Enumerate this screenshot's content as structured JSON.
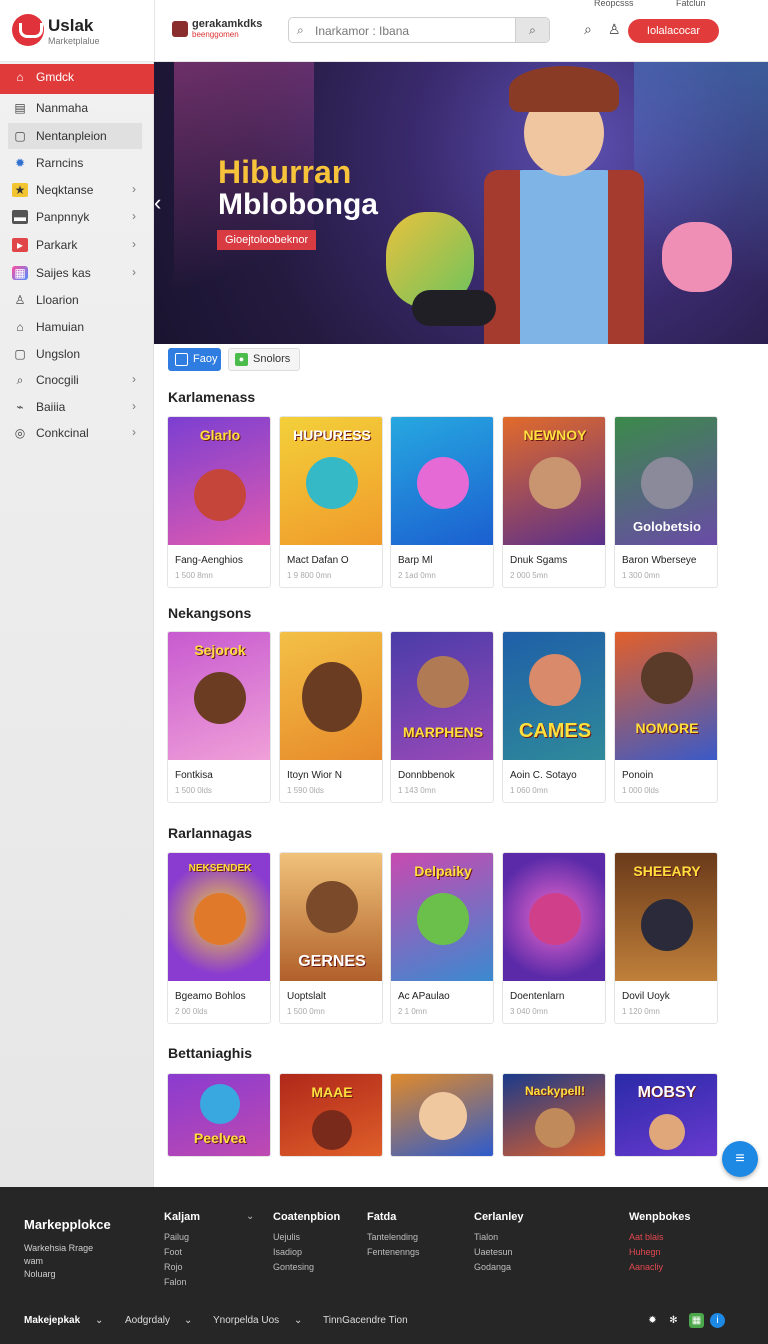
{
  "header": {
    "logo_name": "Uslak",
    "logo_sub": "Marketplalue",
    "brand2_name": "gerakamkdks",
    "brand2_sub": "beenggomen",
    "search_placeholder": "Inarkamor : Ibana",
    "cta_label": "Iolalacocar",
    "topmini_left": "Reopcsss",
    "topmini_right": "Fatclun"
  },
  "sidebar": {
    "items": [
      {
        "label": "Gmdck",
        "icon": "home-icon"
      },
      {
        "label": "Nanmaha",
        "icon": "list-icon"
      },
      {
        "label": "Nentanpleion",
        "icon": "page-icon"
      },
      {
        "label": "Rarncins",
        "icon": "gear-icon"
      },
      {
        "label": "Neqktanse",
        "icon": "star-icon"
      },
      {
        "label": "Panpnnyk",
        "icon": "monitor-icon"
      },
      {
        "label": "Parkark",
        "icon": "play-icon"
      },
      {
        "label": "Saijes kas",
        "icon": "apps-icon"
      },
      {
        "label": "Lloarion",
        "icon": "people-icon"
      },
      {
        "label": "Hamuian",
        "icon": "house-icon"
      },
      {
        "label": "Ungslon",
        "icon": "square-icon"
      },
      {
        "label": "Cnocgili",
        "icon": "search-icon"
      },
      {
        "label": "Baiiia",
        "icon": "chart-icon"
      },
      {
        "label": "Conkcinal",
        "icon": "circle-icon"
      }
    ]
  },
  "hero": {
    "title1": "Hiburran",
    "title2": "Mblobonga",
    "tag": "Gioejtoloobeknor"
  },
  "chips": [
    {
      "label": "Faoy"
    },
    {
      "label": "Snolors"
    }
  ],
  "sections": [
    {
      "title": "Karlamenass",
      "cards": [
        {
          "art_text": "Glarlo",
          "title": "Fang-Aenghios",
          "sub": "1 500 8mn"
        },
        {
          "art_text": "HUPURESS",
          "title": "Mact Dafan O",
          "sub": "1 9 800 0mn"
        },
        {
          "art_text": "",
          "title": "Barp Ml",
          "sub": "2 1ad 0mn"
        },
        {
          "art_text": "NEWNOY",
          "title": "Dnuk Sgams",
          "sub": "2 000 5mn"
        },
        {
          "art_text": "Golobetsio",
          "title": "Baron Wberseye",
          "sub": "1 300 0mn"
        }
      ]
    },
    {
      "title": "Nekangsons",
      "cards": [
        {
          "art_text": "Sejorok",
          "title": "Fontkisa",
          "sub": "1 500 0lds"
        },
        {
          "art_text": "",
          "title": "Itoyn Wior N",
          "sub": "1 590 0lds"
        },
        {
          "art_text": "MARPHENS",
          "title": "Donnbbenok",
          "sub": "1 143 0mn"
        },
        {
          "art_text": "CAMES",
          "title": "Aoin C. Sotayo",
          "sub": "1 060 0mn"
        },
        {
          "art_text": "NOMORE",
          "title": "Ponoin",
          "sub": "1 000 0lds"
        }
      ]
    },
    {
      "title": "Rarlannagas",
      "cards": [
        {
          "art_text": "NEKSENDEK",
          "title": "Bgeamo Bohlos",
          "sub": "2 00 0lds"
        },
        {
          "art_text": "GERNES",
          "title": "Uoptslalt",
          "sub": "1 500 0mn"
        },
        {
          "art_text": "Delpaiky",
          "title": "Ac APaulao",
          "sub": "2 1 0mn"
        },
        {
          "art_text": "",
          "title": "Doentenlarn",
          "sub": "3 040 0mn"
        },
        {
          "art_text": "SHEEARY",
          "title": "Dovil Uoyk",
          "sub": "1 120 0mn"
        }
      ]
    },
    {
      "title": "Bettaniaghis",
      "cards": [
        {
          "art_text": "Peelvea",
          "title": "",
          "sub": ""
        },
        {
          "art_text": "MAAE",
          "title": "",
          "sub": ""
        },
        {
          "art_text": "",
          "title": "",
          "sub": ""
        },
        {
          "art_text": "Nackypell!",
          "title": "",
          "sub": ""
        },
        {
          "art_text": "MOBSY",
          "title": "",
          "sub": ""
        }
      ]
    }
  ],
  "footer": {
    "brand": "Markepplokce",
    "brand_lines": [
      "Warkehsia Rrage",
      "wam",
      "Noluarg"
    ],
    "columns": [
      {
        "title": "Kaljam",
        "links": [
          "Pailug",
          "Foot",
          "Rojo",
          "Falon"
        ],
        "red": false
      },
      {
        "title": "Coatenpbion",
        "links": [
          "Uejulis",
          "Isadiop",
          "Gontesing"
        ],
        "red": false
      },
      {
        "title": "Fatda",
        "links": [
          "Tantelending",
          "Fentenenngs"
        ],
        "red": false
      },
      {
        "title": "Cerlanley",
        "links": [
          "Tialon",
          "Uaetesun",
          "Godanga"
        ],
        "red": false
      },
      {
        "title": "Wenpbokes",
        "links": [
          "Aat blais",
          "Huhegn",
          "Aanacliy"
        ],
        "red": true
      }
    ],
    "bottom": [
      "Makejepkak",
      "Aodgrdaly",
      "Ynorpelda Uos",
      "TinnGacendre Tion"
    ]
  },
  "colors": {
    "accent": "#e03a3a",
    "link_blue": "#2f7de0",
    "footer_bg": "#262626"
  }
}
